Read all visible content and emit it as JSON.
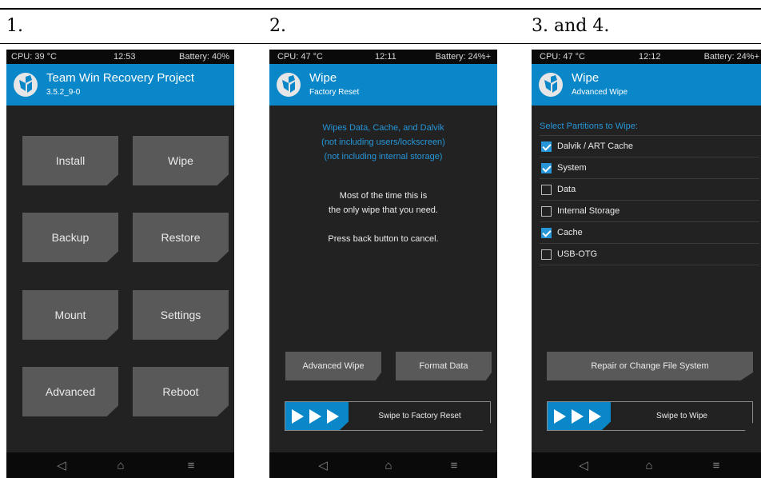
{
  "captions": {
    "step1": "1.",
    "step2": "2.",
    "step3": "3. and 4."
  },
  "colors": {
    "accent": "#0a87c8",
    "panel_bg": "#222222",
    "button": "#595959",
    "blue_text": "#2696d8"
  },
  "icons": {
    "logo": "twrp-logo-icon",
    "nav_back": "back-triangle-icon",
    "nav_home": "home-icon",
    "nav_menu": "menu-lines-icon",
    "swipe": "double-chevron-arrows-icon"
  },
  "screen1": {
    "status": {
      "cpu": "CPU: 39 °C",
      "time": "12:53",
      "battery": "Battery: 40%"
    },
    "title": "Team Win Recovery Project",
    "subtitle": "3.5.2_9-0",
    "buttons": [
      "Install",
      "Wipe",
      "Backup",
      "Restore",
      "Mount",
      "Settings",
      "Advanced",
      "Reboot"
    ]
  },
  "screen2": {
    "status": {
      "cpu": "CPU: 47 °C",
      "time": "12:11",
      "battery": "Battery: 24%+"
    },
    "title": "Wipe",
    "subtitle": "Factory Reset",
    "info_lines": [
      "Wipes Data, Cache, and Dalvik",
      "(not including users/lockscreen)",
      "(not including internal storage)"
    ],
    "note_lines": [
      "Most of the time this is",
      "the only wipe that you need."
    ],
    "cancel_text": "Press back button to cancel.",
    "advanced_wipe": "Advanced Wipe",
    "format_data": "Format Data",
    "swipe_text": "Swipe to Factory Reset"
  },
  "screen3": {
    "status": {
      "cpu": "CPU: 47 °C",
      "time": "12:12",
      "battery": "Battery: 24%+"
    },
    "title": "Wipe",
    "subtitle": "Advanced Wipe",
    "select_heading": "Select Partitions to Wipe:",
    "partitions": [
      {
        "label": "Dalvik / ART Cache",
        "checked": true
      },
      {
        "label": "System",
        "checked": true
      },
      {
        "label": "Data",
        "checked": false
      },
      {
        "label": "Internal Storage",
        "checked": false
      },
      {
        "label": "Cache",
        "checked": true
      },
      {
        "label": "USB-OTG",
        "checked": false
      }
    ],
    "repair_button": "Repair or Change File System",
    "swipe_text": "Swipe to Wipe"
  }
}
